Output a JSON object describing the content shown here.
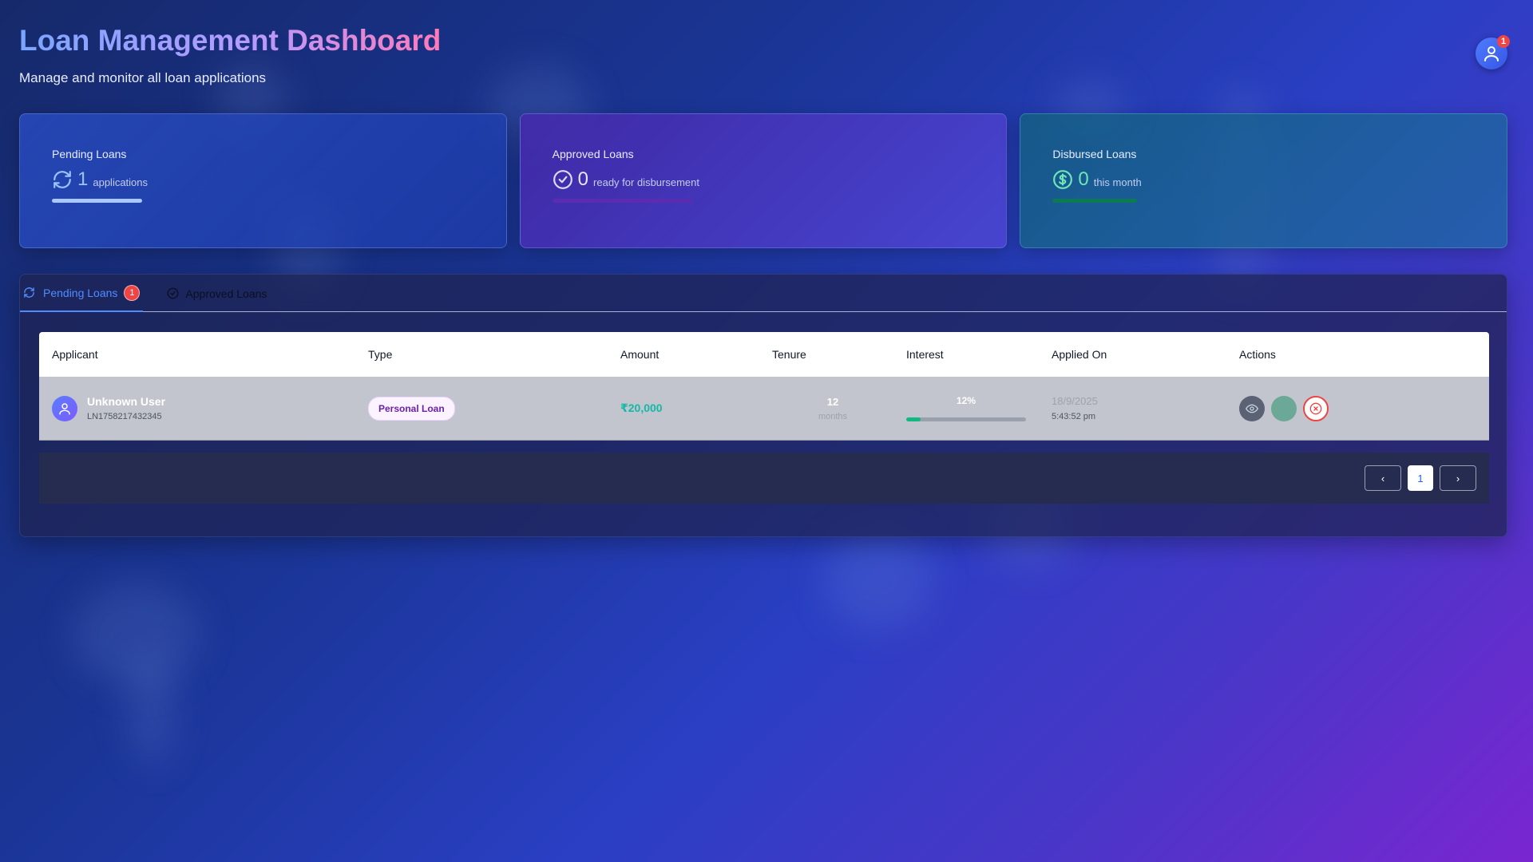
{
  "header": {
    "title": "Loan Management Dashboard",
    "subtitle": "Manage and monitor all loan applications",
    "notification_count": "1"
  },
  "stats": [
    {
      "label": "Pending Loans",
      "value": "1",
      "unit": "applications",
      "icon": "refresh-icon",
      "accent": "#9ec1ff",
      "bar_color": "#a9c8ff"
    },
    {
      "label": "Approved Loans",
      "value": "0",
      "unit": "ready for disbursement",
      "icon": "check-circle-icon",
      "accent": "#d9ddff",
      "bar_color": "#5b2bb0"
    },
    {
      "label": "Disbursed Loans",
      "value": "0",
      "unit": "this month",
      "icon": "dollar-circle-icon",
      "accent": "#6ee7b7",
      "bar_color": "#0c7a52"
    }
  ],
  "tabs": [
    {
      "label": "Pending Loans",
      "badge": "1",
      "icon": "refresh-icon",
      "active": true
    },
    {
      "label": "Approved Loans",
      "icon": "check-circle-icon",
      "active": false
    }
  ],
  "table": {
    "columns": [
      "Applicant",
      "Type",
      "Amount",
      "Tenure",
      "Interest",
      "Applied On",
      "Actions"
    ],
    "rows": [
      {
        "name": "Unknown User",
        "loan_id": "LN1758217432345",
        "type": "Personal Loan",
        "amount": "₹20,000",
        "tenure": "12",
        "tenure_unit": "months",
        "interest": "12%",
        "interest_fraction": 0.12,
        "applied_date": "18/9/2025",
        "applied_time": "5:43:52 pm",
        "actions": [
          "eye-icon",
          "approve-button",
          "x-circle-icon"
        ]
      }
    ]
  },
  "pagination": {
    "prev": "‹",
    "current": "1",
    "next": "›"
  }
}
